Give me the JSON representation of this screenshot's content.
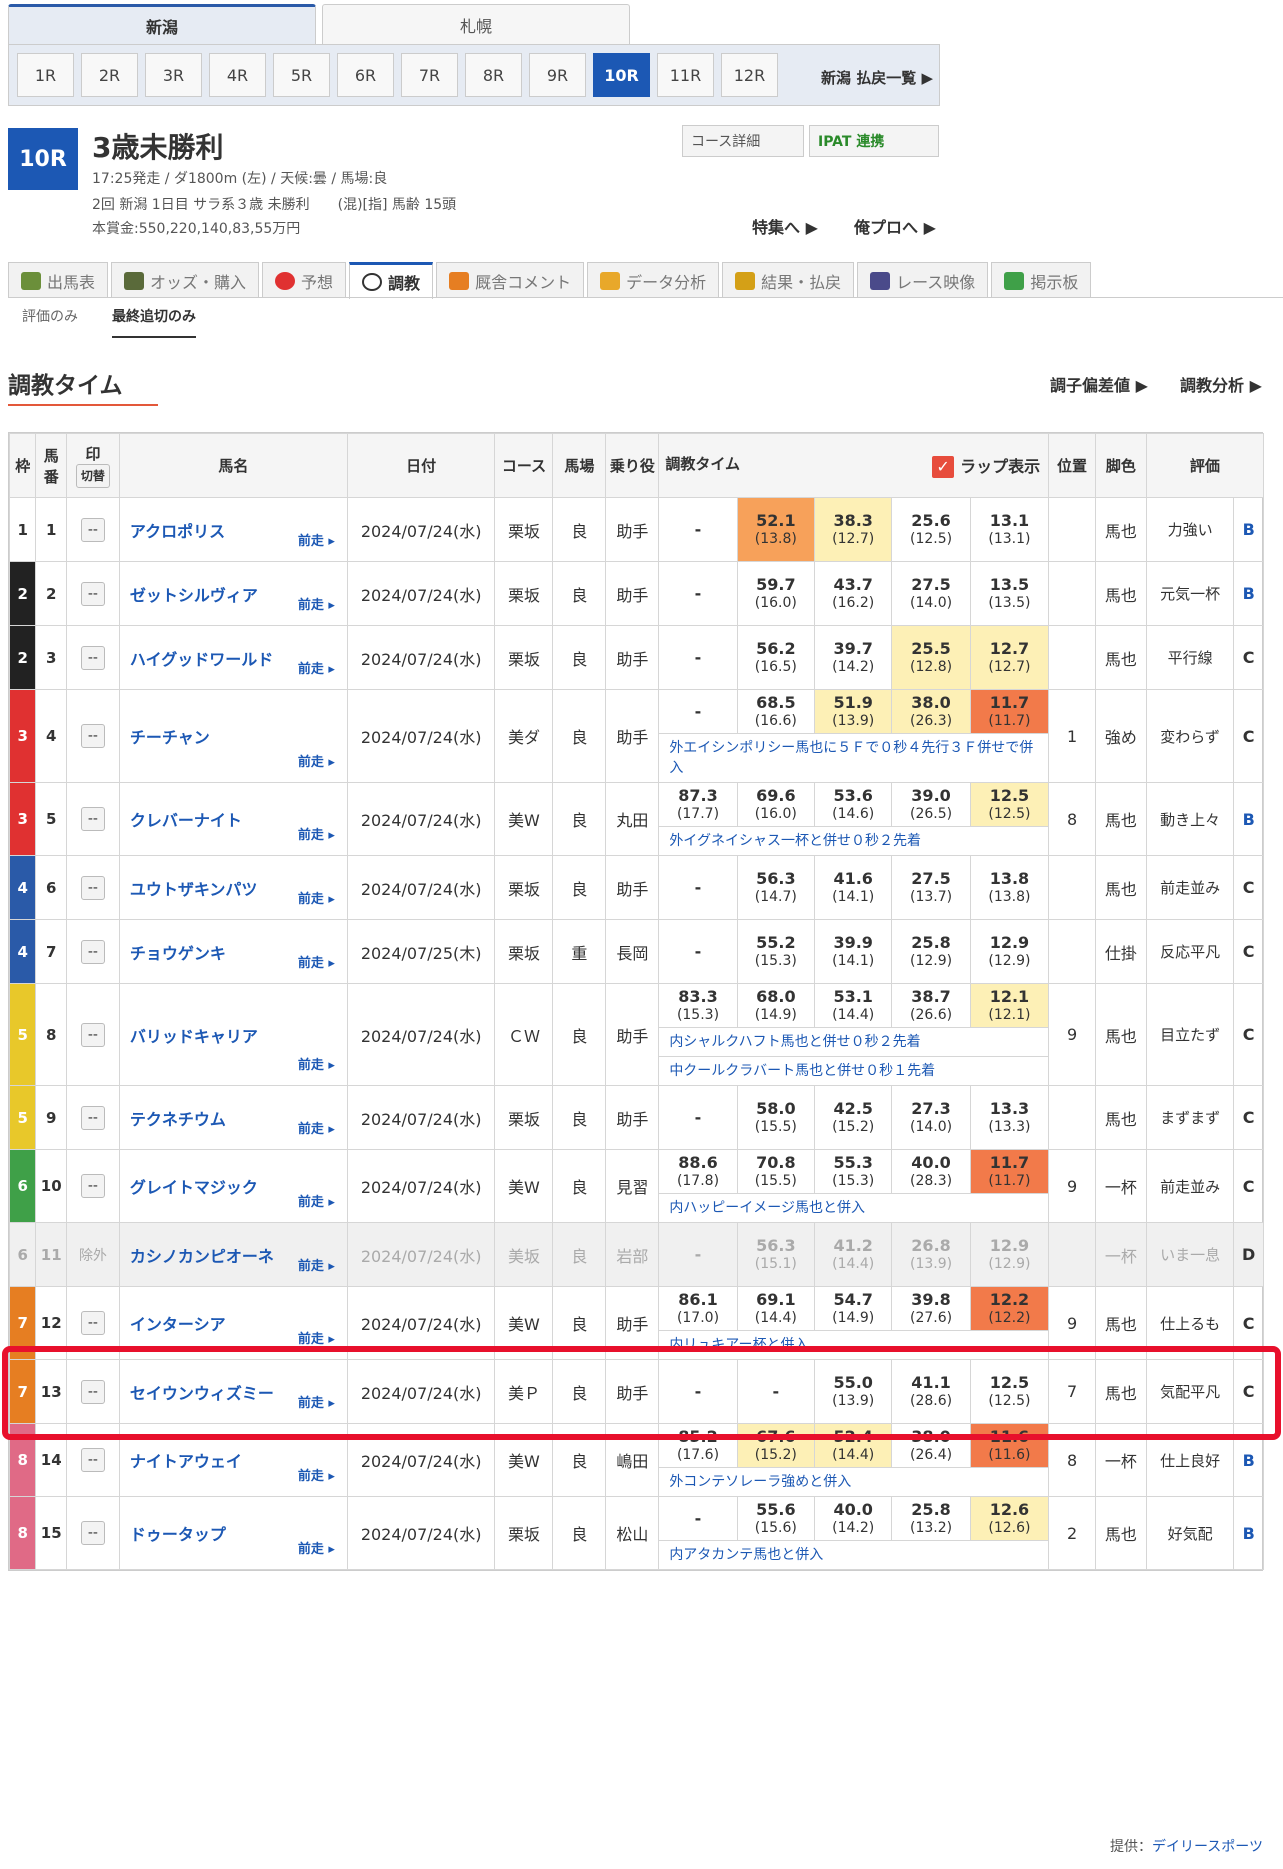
{
  "venues": [
    "新潟",
    "札幌"
  ],
  "races": [
    "1R",
    "2R",
    "3R",
    "4R",
    "5R",
    "6R",
    "7R",
    "8R",
    "9R",
    "10R",
    "11R",
    "12R"
  ],
  "payout_link": "新潟 払戻一覧",
  "race": {
    "number": "10R",
    "title": "3歳未勝利",
    "info1": "17:25発走 / ダ1800m (左) / 天候:曇 / 馬場:良",
    "info2": "2回 新潟 1日目 サラ系３歳 未勝利　　(混)[指] 馬齢 15頭",
    "info3": "本賞金:550,220,140,83,55万円"
  },
  "buttons": {
    "course": "コース詳細",
    "ipat": "IPAT 連携"
  },
  "features": {
    "feature": "特集へ",
    "mypro": "俺プロへ"
  },
  "main_tabs": [
    "出馬表",
    "オッズ・購入",
    "予想",
    "調教",
    "厩舎コメント",
    "データ分析",
    "結果・払戻",
    "レース映像",
    "掲示板"
  ],
  "sub_tabs": [
    "評価のみ",
    "最終追切のみ"
  ],
  "section": {
    "title": "調教タイム",
    "link1": "調子偏差値",
    "link2": "調教分析"
  },
  "headers": {
    "waku": "枠",
    "umaban": "馬番",
    "mark": "印",
    "mark_sw": "切替",
    "name": "馬名",
    "date": "日付",
    "course": "コース",
    "baba": "馬場",
    "rider": "乗り役",
    "time": "調教タイム",
    "lap": "ラップ表示",
    "pos": "位置",
    "ashi": "脚色",
    "eval": "評価"
  },
  "prev_label": "前走",
  "rows": [
    {
      "waku": "1",
      "uma": "1",
      "mark": "--",
      "name": "アクロポリス",
      "date": "2024/07/24(水)",
      "course": "栗坂",
      "baba": "良",
      "rider": "助手",
      "t1": "-",
      "t2": "52.1",
      "l2": "(13.8)",
      "t3": "38.3",
      "l3": "(12.7)",
      "t4": "25.6",
      "l4": "(12.5)",
      "t5": "13.1",
      "l5": "(13.1)",
      "pos": "",
      "ashi": "馬也",
      "comment": "力強い",
      "rank": "B"
    },
    {
      "waku": "2",
      "uma": "2",
      "mark": "--",
      "name": "ゼットシルヴィア",
      "date": "2024/07/24(水)",
      "course": "栗坂",
      "baba": "良",
      "rider": "助手",
      "t1": "-",
      "t2": "59.7",
      "l2": "(16.0)",
      "t3": "43.7",
      "l3": "(16.2)",
      "t4": "27.5",
      "l4": "(14.0)",
      "t5": "13.5",
      "l5": "(13.5)",
      "pos": "",
      "ashi": "馬也",
      "comment": "元気一杯",
      "rank": "B"
    },
    {
      "waku": "2",
      "uma": "3",
      "mark": "--",
      "name": "ハイグッドワールド",
      "date": "2024/07/24(水)",
      "course": "栗坂",
      "baba": "良",
      "rider": "助手",
      "t1": "-",
      "t2": "56.2",
      "l2": "(16.5)",
      "t3": "39.7",
      "l3": "(14.2)",
      "t4": "25.5",
      "l4": "(12.8)",
      "t5": "12.7",
      "l5": "(12.7)",
      "pos": "",
      "ashi": "馬也",
      "comment": "平行線",
      "rank": "C"
    },
    {
      "waku": "3",
      "uma": "4",
      "mark": "--",
      "name": "チーチャン",
      "date": "2024/07/24(水)",
      "course": "美ダ",
      "baba": "良",
      "rider": "助手",
      "t1": "-",
      "t2": "68.5",
      "l2": "(16.6)",
      "t3": "51.9",
      "l3": "(13.9)",
      "t4": "38.0",
      "l4": "(26.3)",
      "t5": "11.7",
      "l5": "(11.7)",
      "pos": "1",
      "ashi": "強め",
      "comment": "変わらず",
      "rank": "C",
      "note": "外エイシンポリシー馬也に５Ｆで０秒４先行３Ｆ併せで併入"
    },
    {
      "waku": "3",
      "uma": "5",
      "mark": "--",
      "name": "クレバーナイト",
      "date": "2024/07/24(水)",
      "course": "美W",
      "baba": "良",
      "rider": "丸田",
      "t1": "87.3",
      "l1": "(17.7)",
      "t2": "69.6",
      "l2": "(16.0)",
      "t3": "53.6",
      "l3": "(14.6)",
      "t4": "39.0",
      "l4": "(26.5)",
      "t5": "12.5",
      "l5": "(12.5)",
      "pos": "8",
      "ashi": "馬也",
      "comment": "動き上々",
      "rank": "B",
      "note": "外イグネイシャス一杯と併せ０秒２先着"
    },
    {
      "waku": "4",
      "uma": "6",
      "mark": "--",
      "name": "ユウトザキンパツ",
      "date": "2024/07/24(水)",
      "course": "栗坂",
      "baba": "良",
      "rider": "助手",
      "t1": "-",
      "t2": "56.3",
      "l2": "(14.7)",
      "t3": "41.6",
      "l3": "(14.1)",
      "t4": "27.5",
      "l4": "(13.7)",
      "t5": "13.8",
      "l5": "(13.8)",
      "pos": "",
      "ashi": "馬也",
      "comment": "前走並み",
      "rank": "C"
    },
    {
      "waku": "4",
      "uma": "7",
      "mark": "--",
      "name": "チョウゲンキ",
      "date": "2024/07/25(木)",
      "course": "栗坂",
      "baba": "重",
      "rider": "長岡",
      "t1": "-",
      "t2": "55.2",
      "l2": "(15.3)",
      "t3": "39.9",
      "l3": "(14.1)",
      "t4": "25.8",
      "l4": "(12.9)",
      "t5": "12.9",
      "l5": "(12.9)",
      "pos": "",
      "ashi": "仕掛",
      "comment": "反応平凡",
      "rank": "C"
    },
    {
      "waku": "5",
      "uma": "8",
      "mark": "--",
      "name": "バリッドキャリア",
      "date": "2024/07/24(水)",
      "course": "ＣＷ",
      "baba": "良",
      "rider": "助手",
      "t1": "83.3",
      "l1": "(15.3)",
      "t2": "68.0",
      "l2": "(14.9)",
      "t3": "53.1",
      "l3": "(14.4)",
      "t4": "38.7",
      "l4": "(26.6)",
      "t5": "12.1",
      "l5": "(12.1)",
      "pos": "9",
      "ashi": "馬也",
      "comment": "目立たず",
      "rank": "C",
      "note": "内シャルクハフト馬也と併せ０秒２先着",
      "note2": "中クールクラバート馬也と併せ０秒１先着"
    },
    {
      "waku": "5",
      "uma": "9",
      "mark": "--",
      "name": "テクネチウム",
      "date": "2024/07/24(水)",
      "course": "栗坂",
      "baba": "良",
      "rider": "助手",
      "t1": "-",
      "t2": "58.0",
      "l2": "(15.5)",
      "t3": "42.5",
      "l3": "(15.2)",
      "t4": "27.3",
      "l4": "(14.0)",
      "t5": "13.3",
      "l5": "(13.3)",
      "pos": "",
      "ashi": "馬也",
      "comment": "まずまず",
      "rank": "C"
    },
    {
      "waku": "6",
      "uma": "10",
      "mark": "--",
      "name": "グレイトマジック",
      "date": "2024/07/24(水)",
      "course": "美W",
      "baba": "良",
      "rider": "見習",
      "t1": "88.6",
      "l1": "(17.8)",
      "t2": "70.8",
      "l2": "(15.5)",
      "t3": "55.3",
      "l3": "(15.3)",
      "t4": "40.0",
      "l4": "(28.3)",
      "t5": "11.7",
      "l5": "(11.7)",
      "pos": "9",
      "ashi": "一杯",
      "comment": "前走並み",
      "rank": "C",
      "note": "内ハッピーイメージ馬也と併入"
    },
    {
      "waku": "6",
      "uma": "11",
      "mark": "除外",
      "name": "カシノカンピオーネ",
      "date": "2024/07/24(水)",
      "course": "美坂",
      "baba": "良",
      "rider": "岩部",
      "t1": "-",
      "t2": "56.3",
      "l2": "(15.1)",
      "t3": "41.2",
      "l3": "(14.4)",
      "t4": "26.8",
      "l4": "(13.9)",
      "t5": "12.9",
      "l5": "(12.9)",
      "pos": "",
      "ashi": "一杯",
      "comment": "いま一息",
      "rank": "D"
    },
    {
      "waku": "7",
      "uma": "12",
      "mark": "--",
      "name": "インターシア",
      "date": "2024/07/24(水)",
      "course": "美W",
      "baba": "良",
      "rider": "助手",
      "t1": "86.1",
      "l1": "(17.0)",
      "t2": "69.1",
      "l2": "(14.4)",
      "t3": "54.7",
      "l3": "(14.9)",
      "t4": "39.8",
      "l4": "(27.6)",
      "t5": "12.2",
      "l5": "(12.2)",
      "pos": "9",
      "ashi": "馬也",
      "comment": "仕上るも",
      "rank": "C",
      "note": "内リュキアー杯と併入"
    },
    {
      "waku": "7",
      "uma": "13",
      "mark": "--",
      "name": "セイウンウィズミー",
      "date": "2024/07/24(水)",
      "course": "美Ｐ",
      "baba": "良",
      "rider": "助手",
      "t1": "-",
      "t2": "-",
      "t3": "55.0",
      "l3": "(13.9)",
      "t4": "41.1",
      "l4": "(28.6)",
      "t5": "12.5",
      "l5": "(12.5)",
      "pos": "7",
      "ashi": "馬也",
      "comment": "気配平凡",
      "rank": "C"
    },
    {
      "waku": "8",
      "uma": "14",
      "mark": "--",
      "name": "ナイトアウェイ",
      "date": "2024/07/24(水)",
      "course": "美W",
      "baba": "良",
      "rider": "嶋田",
      "t1": "85.2",
      "l1": "(17.6)",
      "t2": "67.6",
      "l2": "(15.2)",
      "t3": "52.4",
      "l3": "(14.4)",
      "t4": "38.0",
      "l4": "(26.4)",
      "t5": "11.6",
      "l5": "(11.6)",
      "pos": "8",
      "ashi": "一杯",
      "comment": "仕上良好",
      "rank": "B",
      "note": "外コンテソレーラ強めと併入"
    },
    {
      "waku": "8",
      "uma": "15",
      "mark": "--",
      "name": "ドゥータップ",
      "date": "2024/07/24(水)",
      "course": "栗坂",
      "baba": "良",
      "rider": "松山",
      "t1": "-",
      "t2": "55.6",
      "l2": "(15.6)",
      "t3": "40.0",
      "l3": "(14.2)",
      "t4": "25.8",
      "l4": "(13.2)",
      "t5": "12.6",
      "l5": "(12.6)",
      "pos": "2",
      "ashi": "馬也",
      "comment": "好気配",
      "rank": "B",
      "note": "内アタカンテ馬也と併入"
    }
  ],
  "credit_prefix": "提供：",
  "credit_name": "デイリースポーツ"
}
